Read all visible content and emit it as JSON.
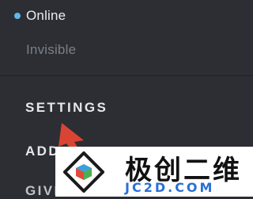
{
  "status_menu": {
    "online": {
      "label": "Online",
      "dot_color": "#5fb7e6"
    },
    "invisible": {
      "label": "Invisible"
    }
  },
  "section_menu": {
    "settings": "SETTINGS",
    "add": "ADD",
    "give": "GIVE"
  },
  "watermark": {
    "title": "极创二维",
    "domain": "JC2D.COM"
  }
}
